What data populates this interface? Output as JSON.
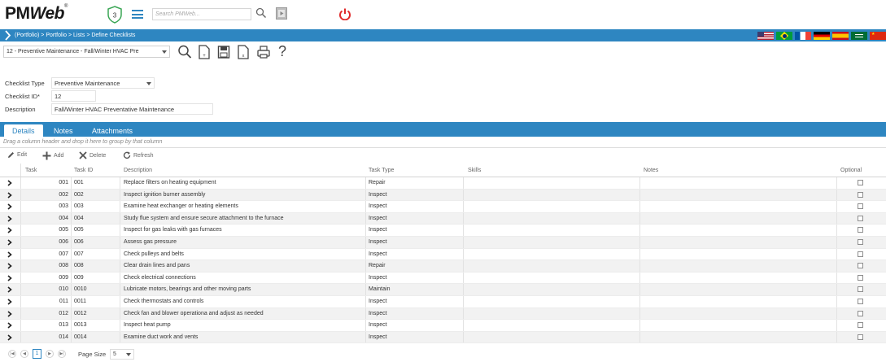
{
  "app": {
    "logo_text_a": "PM",
    "logo_text_b": "Web",
    "logo_mark": "®",
    "notifications_count": "3",
    "search_placeholder": "Search PMWeb..."
  },
  "breadcrumb": {
    "text": "(Portfolio) > Portfolio > Lists > Define Checklists"
  },
  "flags": [
    "us-flag",
    "brazil-flag",
    "france-flag",
    "germany-flag",
    "spain-flag",
    "saudi-flag",
    "china-flag"
  ],
  "toolbar": {
    "record_selector": "12 - Preventive Maintenance - Fall/Winter HVAC Pre",
    "help_label": "?"
  },
  "form": {
    "checklist_type_label": "Checklist Type",
    "checklist_type_value": "Preventive Maintenance",
    "checklist_id_label": "Checklist ID*",
    "checklist_id_value": "12",
    "description_label": "Description",
    "description_value": "Fall/Winter HVAC Preventative Maintenance"
  },
  "tabs": [
    {
      "label": "Details",
      "active": true
    },
    {
      "label": "Notes",
      "active": false
    },
    {
      "label": "Attachments",
      "active": false
    }
  ],
  "group_hint": "Drag a column header and drop it here to group by that column",
  "grid_tools": {
    "edit": "Edit",
    "add": "Add",
    "delete": "Delete",
    "refresh": "Refresh"
  },
  "columns": {
    "task": "Task",
    "task_id": "Task ID",
    "description": "Description",
    "task_type": "Task Type",
    "skills": "Skills",
    "notes": "Notes",
    "optional": "Optional"
  },
  "rows": [
    {
      "task": "001",
      "task_id": "001",
      "description": "Replace filters on heating equipment",
      "task_type": "Repair"
    },
    {
      "task": "002",
      "task_id": "002",
      "description": "Inspect ignition burner assembly",
      "task_type": "Inspect"
    },
    {
      "task": "003",
      "task_id": "003",
      "description": "Examine heat exchanger or heating elements",
      "task_type": "Inspect"
    },
    {
      "task": "004",
      "task_id": "004",
      "description": "Study flue system and ensure secure attachment to the furnace",
      "task_type": "Inspect"
    },
    {
      "task": "005",
      "task_id": "005",
      "description": "Inspect for gas leaks with gas furnaces",
      "task_type": "Inspect"
    },
    {
      "task": "006",
      "task_id": "006",
      "description": "Assess gas pressure",
      "task_type": "Inspect"
    },
    {
      "task": "007",
      "task_id": "007",
      "description": "Check pulleys and belts",
      "task_type": "Inspect"
    },
    {
      "task": "008",
      "task_id": "008",
      "description": "Clear drain lines and pans",
      "task_type": "Repair"
    },
    {
      "task": "009",
      "task_id": "009",
      "description": "Check electrical connections",
      "task_type": "Inspect"
    },
    {
      "task": "010",
      "task_id": "0010",
      "description": "Lubricate motors, bearings and other moving parts",
      "task_type": "Maintain"
    },
    {
      "task": "011",
      "task_id": "0011",
      "description": "Check thermostats and controls",
      "task_type": "Inspect"
    },
    {
      "task": "012",
      "task_id": "0012",
      "description": "Check fan and blower operationa and adjust as needed",
      "task_type": "Inspect"
    },
    {
      "task": "013",
      "task_id": "0013",
      "description": "Inspect heat pump",
      "task_type": "Inspect"
    },
    {
      "task": "014",
      "task_id": "0014",
      "description": "Examine duct work and vents",
      "task_type": "Inspect"
    }
  ],
  "pager": {
    "current_page": "1",
    "page_size_label": "Page Size",
    "page_size_value": "5"
  },
  "colors": {
    "accent": "#2e86c1",
    "power": "#e02a2a",
    "shield": "#3aa655"
  }
}
